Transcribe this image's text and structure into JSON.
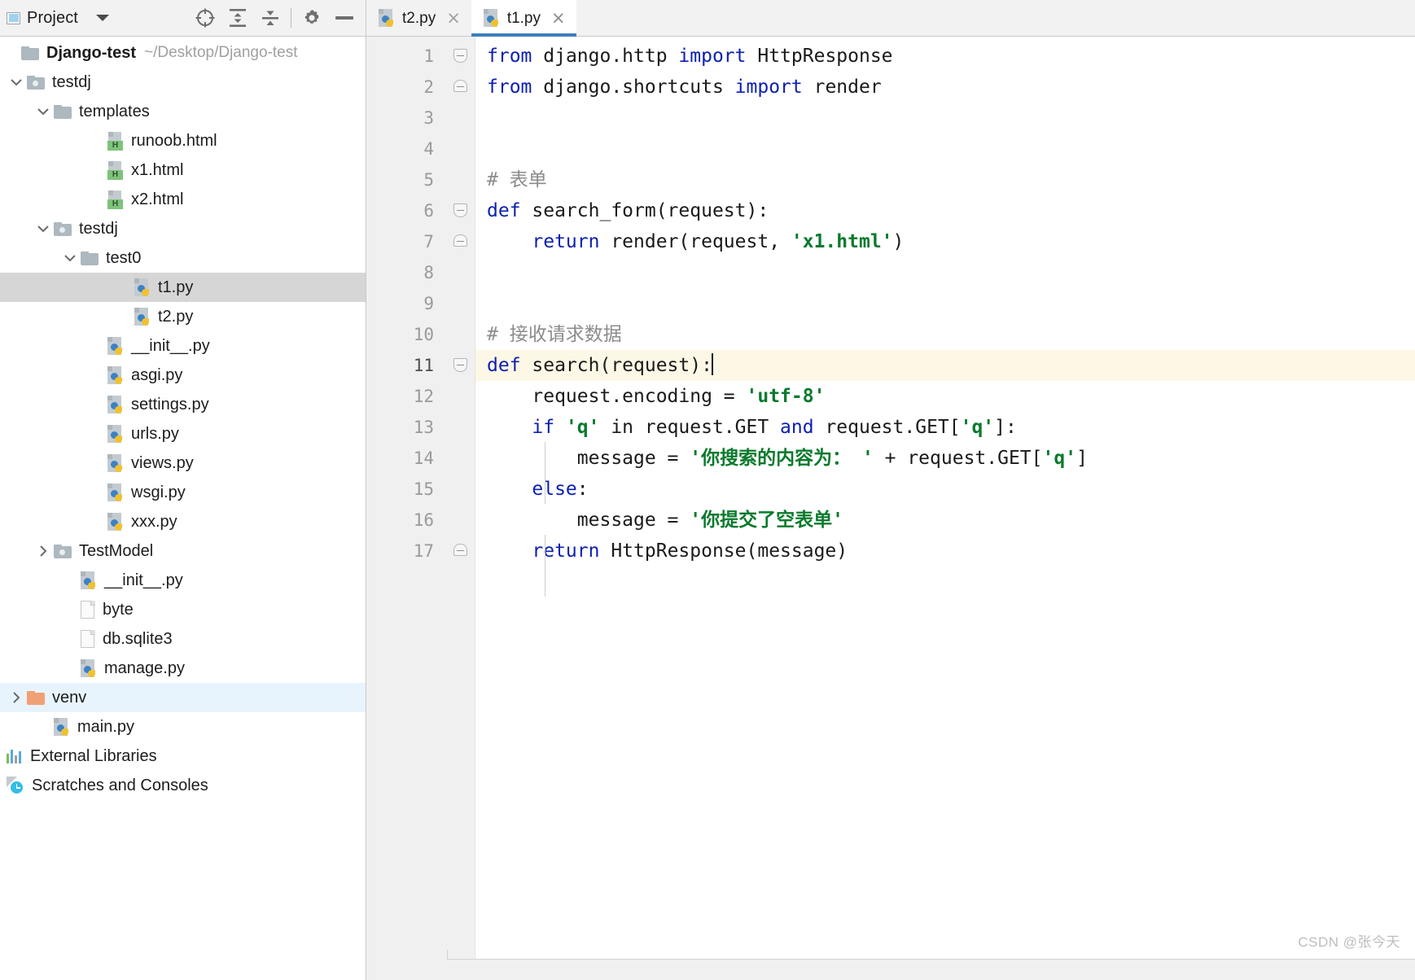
{
  "toolbar": {
    "project_label": "Project",
    "project_icon": "project-panel-icon",
    "dropdown_icon": "chevron-down-icon",
    "buttons": [
      {
        "name": "select-opened-file-icon",
        "icon": "crosshair-target-icon"
      },
      {
        "name": "expand-all-icon",
        "icon": "expand-all-icon"
      },
      {
        "name": "collapse-all-icon",
        "icon": "collapse-all-icon"
      },
      {
        "name": "settings-icon",
        "icon": "gear-icon"
      },
      {
        "name": "hide-panel-icon",
        "icon": "minus-icon"
      }
    ]
  },
  "tabs": [
    {
      "label": "t2.py",
      "icon": "python-file-icon",
      "active": false,
      "close": "×"
    },
    {
      "label": "t1.py",
      "icon": "python-file-icon",
      "active": true,
      "close": "×"
    }
  ],
  "tree": {
    "root": {
      "label": "Django-test",
      "path": "~/Desktop/Django-test",
      "icon": "folder-icon"
    },
    "items": [
      {
        "label": "testdj",
        "indent": 1,
        "icon": "module-folder-icon",
        "chev": "down",
        "state": ""
      },
      {
        "label": "templates",
        "indent": 2,
        "icon": "folder-icon",
        "chev": "down",
        "state": ""
      },
      {
        "label": "runoob.html",
        "indent": 4,
        "icon": "html-file-icon",
        "chev": "",
        "state": "",
        "badge": "H"
      },
      {
        "label": "x1.html",
        "indent": 4,
        "icon": "html-file-icon",
        "chev": "",
        "state": "",
        "badge": "H"
      },
      {
        "label": "x2.html",
        "indent": 4,
        "icon": "html-file-icon",
        "chev": "",
        "state": "",
        "badge": "H"
      },
      {
        "label": "testdj",
        "indent": 2,
        "icon": "module-folder-icon",
        "chev": "down",
        "state": ""
      },
      {
        "label": "test0",
        "indent": 3,
        "icon": "folder-icon",
        "chev": "down",
        "state": ""
      },
      {
        "label": "t1.py",
        "indent": 5,
        "icon": "python-file-icon",
        "chev": "",
        "state": "selected"
      },
      {
        "label": "t2.py",
        "indent": 5,
        "icon": "python-file-icon",
        "chev": "",
        "state": ""
      },
      {
        "label": "__init__.py",
        "indent": 4,
        "icon": "python-file-icon",
        "chev": "",
        "state": ""
      },
      {
        "label": "asgi.py",
        "indent": 4,
        "icon": "python-file-icon",
        "chev": "",
        "state": ""
      },
      {
        "label": "settings.py",
        "indent": 4,
        "icon": "python-file-icon",
        "chev": "",
        "state": ""
      },
      {
        "label": "urls.py",
        "indent": 4,
        "icon": "python-file-icon",
        "chev": "",
        "state": ""
      },
      {
        "label": "views.py",
        "indent": 4,
        "icon": "python-file-icon",
        "chev": "",
        "state": ""
      },
      {
        "label": "wsgi.py",
        "indent": 4,
        "icon": "python-file-icon",
        "chev": "",
        "state": ""
      },
      {
        "label": "xxx.py",
        "indent": 4,
        "icon": "python-file-icon",
        "chev": "",
        "state": ""
      },
      {
        "label": "TestModel",
        "indent": 2,
        "icon": "module-folder-icon",
        "chev": "right",
        "state": ""
      },
      {
        "label": "__init__.py",
        "indent": 3,
        "icon": "python-file-icon",
        "chev": "",
        "state": ""
      },
      {
        "label": "byte",
        "indent": 3,
        "icon": "plain-file-icon",
        "chev": "",
        "state": ""
      },
      {
        "label": "db.sqlite3",
        "indent": 3,
        "icon": "plain-file-icon",
        "chev": "",
        "state": ""
      },
      {
        "label": "manage.py",
        "indent": 3,
        "icon": "python-file-icon",
        "chev": "",
        "state": ""
      },
      {
        "label": "venv",
        "indent": 1,
        "icon": "orange-folder-icon",
        "chev": "right",
        "state": "highlight"
      },
      {
        "label": "main.py",
        "indent": 2,
        "icon": "python-file-icon",
        "chev": "",
        "state": ""
      }
    ],
    "footer": [
      {
        "label": "External Libraries",
        "icon": "external-libraries-icon"
      },
      {
        "label": "Scratches and Consoles",
        "icon": "scratches-consoles-icon"
      }
    ]
  },
  "editor": {
    "line_numbers": [
      "1",
      "2",
      "3",
      "4",
      "5",
      "6",
      "7",
      "8",
      "9",
      "10",
      "11",
      "12",
      "13",
      "14",
      "15",
      "16",
      "17"
    ],
    "current_line": 11,
    "caret_line": 11,
    "lines": [
      {
        "n": 1,
        "fold": "start",
        "tokens": [
          {
            "t": "from ",
            "c": "kw"
          },
          {
            "t": "django.http ",
            "c": "txt"
          },
          {
            "t": "import ",
            "c": "kw"
          },
          {
            "t": "HttpResponse",
            "c": "txt"
          }
        ]
      },
      {
        "n": 2,
        "fold": "end",
        "tokens": [
          {
            "t": "from ",
            "c": "kw"
          },
          {
            "t": "django.shortcuts ",
            "c": "txt"
          },
          {
            "t": "import ",
            "c": "kw"
          },
          {
            "t": "render",
            "c": "txt"
          }
        ]
      },
      {
        "n": 3,
        "fold": "",
        "tokens": []
      },
      {
        "n": 4,
        "fold": "",
        "tokens": []
      },
      {
        "n": 5,
        "fold": "",
        "tokens": [
          {
            "t": "# 表单",
            "c": "cmt"
          }
        ]
      },
      {
        "n": 6,
        "fold": "start",
        "tokens": [
          {
            "t": "def ",
            "c": "kw"
          },
          {
            "t": "search_form(request):",
            "c": "txt"
          }
        ]
      },
      {
        "n": 7,
        "fold": "end",
        "tokens": [
          {
            "t": "    ",
            "c": "txt"
          },
          {
            "t": "return ",
            "c": "kw"
          },
          {
            "t": "render(request, ",
            "c": "txt"
          },
          {
            "t": "'x1.html'",
            "c": "str"
          },
          {
            "t": ")",
            "c": "txt"
          }
        ]
      },
      {
        "n": 8,
        "fold": "",
        "tokens": []
      },
      {
        "n": 9,
        "fold": "",
        "tokens": []
      },
      {
        "n": 10,
        "fold": "",
        "tokens": [
          {
            "t": "# 接收请求数据",
            "c": "cmt"
          }
        ]
      },
      {
        "n": 11,
        "fold": "start",
        "tokens": [
          {
            "t": "def ",
            "c": "kw"
          },
          {
            "t": "search(request):",
            "c": "txt"
          }
        ]
      },
      {
        "n": 12,
        "fold": "",
        "tokens": [
          {
            "t": "    request.encoding = ",
            "c": "txt"
          },
          {
            "t": "'utf-8'",
            "c": "str"
          }
        ]
      },
      {
        "n": 13,
        "fold": "",
        "tokens": [
          {
            "t": "    ",
            "c": "txt"
          },
          {
            "t": "if ",
            "c": "kw"
          },
          {
            "t": "'q' ",
            "c": "str"
          },
          {
            "t": "in",
            "c": "txt"
          },
          {
            "t": " request.GET ",
            "c": "txt"
          },
          {
            "t": "and",
            "c": "kw"
          },
          {
            "t": " request.GET[",
            "c": "txt"
          },
          {
            "t": "'q'",
            "c": "str"
          },
          {
            "t": "]:",
            "c": "txt"
          }
        ]
      },
      {
        "n": 14,
        "fold": "",
        "tokens": [
          {
            "t": "        message = ",
            "c": "txt"
          },
          {
            "t": "'你搜索的内容为： '",
            "c": "str"
          },
          {
            "t": " + request.GET[",
            "c": "txt"
          },
          {
            "t": "'q'",
            "c": "str"
          },
          {
            "t": "]",
            "c": "txt"
          }
        ]
      },
      {
        "n": 15,
        "fold": "",
        "tokens": [
          {
            "t": "    ",
            "c": "txt"
          },
          {
            "t": "else",
            "c": "kw"
          },
          {
            "t": ":",
            "c": "txt"
          }
        ]
      },
      {
        "n": 16,
        "fold": "",
        "tokens": [
          {
            "t": "        message = ",
            "c": "txt"
          },
          {
            "t": "'你提交了空表单'",
            "c": "str"
          }
        ]
      },
      {
        "n": 17,
        "fold": "end",
        "tokens": [
          {
            "t": "    ",
            "c": "txt"
          },
          {
            "t": "return ",
            "c": "kw"
          },
          {
            "t": "HttpResponse(message)",
            "c": "txt"
          }
        ]
      }
    ]
  },
  "watermark": "CSDN @张今天",
  "colors": {
    "keyword": "#0d20b0",
    "string": "#0a7a2c",
    "comment": "#8c8c8c",
    "tab_underline": "#3d7ebd",
    "current_line_bg": "#fdf8e6",
    "selected_row_bg": "#d6d6d6",
    "highlight_row_bg": "#e8f4fd"
  }
}
